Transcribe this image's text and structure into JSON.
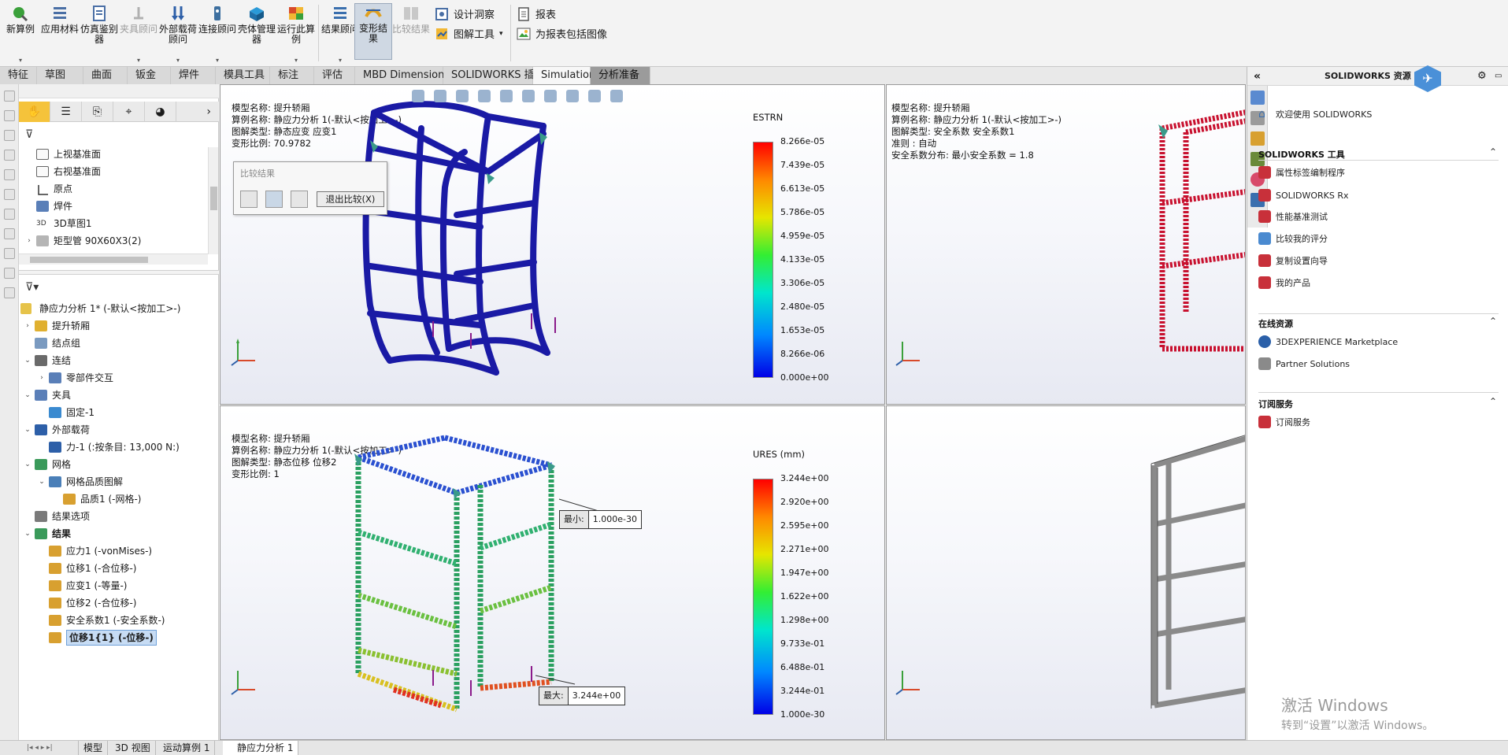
{
  "ribbon": {
    "buttons": [
      {
        "label": "新算例",
        "icon": "new-study-icon",
        "disabled": false,
        "color": "#2f8f2f"
      },
      {
        "label": "应用材料",
        "icon": "apply-material-icon",
        "disabled": false,
        "color": "#4a6fa5"
      },
      {
        "label": "仿真鉴别器",
        "icon": "simulation-evaluator-icon",
        "disabled": false,
        "color": "#4a6fa5"
      },
      {
        "label": "夹具顾问",
        "icon": "fixtures-advisor-icon",
        "disabled": true,
        "color": "#9a9a9a"
      },
      {
        "label": "外部载荷顾问",
        "icon": "external-loads-advisor-icon",
        "disabled": false,
        "color": "#2d5fa8"
      },
      {
        "label": "连接顾问",
        "icon": "connections-advisor-icon",
        "disabled": false,
        "color": "#3d6f9f"
      },
      {
        "label": "壳体管理器",
        "icon": "shell-manager-icon",
        "disabled": false,
        "color": "#1f7fb8"
      },
      {
        "label": "运行此算例",
        "icon": "run-study-icon",
        "disabled": false,
        "color": "#d84a2a"
      },
      {
        "label": "结果顾问",
        "icon": "results-advisor-icon",
        "disabled": false,
        "color": "#3a6fae"
      },
      {
        "label": "变形结果",
        "icon": "deformed-result-icon",
        "disabled": false,
        "active": true,
        "color": "#e0a020"
      },
      {
        "label": "比较结果",
        "icon": "compare-results-icon",
        "disabled": true,
        "color": "#9a9a9a"
      }
    ],
    "text_items": [
      {
        "label": "设计洞察",
        "icon": "design-insight-icon"
      },
      {
        "label": "图解工具",
        "icon": "plot-tools-icon"
      },
      {
        "label": "报表",
        "icon": "report-icon"
      },
      {
        "label": "为报表包括图像",
        "icon": "include-image-icon"
      }
    ]
  },
  "command_tabs": [
    "特征",
    "草图",
    "曲面",
    "钣金",
    "焊件",
    "模具工具",
    "标注",
    "评估",
    "MBD Dimensions",
    "SOLIDWORKS 插件",
    "Simulation",
    "分析准备"
  ],
  "feature_tree": {
    "items": [
      {
        "label": "上视基准面",
        "icon": "plane-icon"
      },
      {
        "label": "右视基准面",
        "icon": "plane-icon"
      },
      {
        "label": "原点",
        "icon": "origin-icon"
      },
      {
        "label": "焊件",
        "icon": "weldment-icon"
      },
      {
        "label": "3D草图1",
        "icon": "sketch3d-icon"
      },
      {
        "label": "矩型管 90X60X3(2)",
        "icon": "cutlist-icon"
      }
    ]
  },
  "sim_tree": {
    "root": "静应力分析 1* (-默认<按加工>-)",
    "items": [
      {
        "label": "提升轿厢",
        "level": 1,
        "arrow": "›",
        "icon": "part-icon"
      },
      {
        "label": "结点组",
        "level": 1,
        "arrow": "",
        "icon": "node-group-icon"
      },
      {
        "label": "连结",
        "level": 1,
        "arrow": "⌄",
        "icon": "connection-icon"
      },
      {
        "label": "零部件交互",
        "level": 2,
        "arrow": "›",
        "icon": "interaction-icon"
      },
      {
        "label": "夹具",
        "level": 1,
        "arrow": "⌄",
        "icon": "fixture-icon"
      },
      {
        "label": "固定-1",
        "level": 2,
        "arrow": "",
        "icon": "fixed-icon"
      },
      {
        "label": "外部载荷",
        "level": 1,
        "arrow": "⌄",
        "icon": "load-icon"
      },
      {
        "label": "力-1 (:按条目: 13,000 N:)",
        "level": 2,
        "arrow": "",
        "icon": "force-icon"
      },
      {
        "label": "网格",
        "level": 1,
        "arrow": "⌄",
        "icon": "mesh-icon"
      },
      {
        "label": "网格品质图解",
        "level": 2,
        "arrow": "⌄",
        "icon": "mesh-quality-icon"
      },
      {
        "label": "品质1 (-网格-)",
        "level": 3,
        "arrow": "",
        "icon": "plot-icon"
      },
      {
        "label": "结果选项",
        "level": 1,
        "arrow": "",
        "icon": "results-options-icon"
      },
      {
        "label": "结果",
        "level": 1,
        "arrow": "⌄",
        "icon": "results-folder-icon",
        "bold": true
      },
      {
        "label": "应力1 (-vonMises-)",
        "level": 2,
        "arrow": "",
        "icon": "plot-icon"
      },
      {
        "label": "位移1 (-合位移-)",
        "level": 2,
        "arrow": "",
        "icon": "plot-icon"
      },
      {
        "label": "应变1 (-等量-)",
        "level": 2,
        "arrow": "",
        "icon": "plot-icon"
      },
      {
        "label": "位移2 (-合位移-)",
        "level": 2,
        "arrow": "",
        "icon": "plot-icon"
      },
      {
        "label": "安全系数1 (-安全系数-)",
        "level": 2,
        "arrow": "",
        "icon": "plot-icon"
      },
      {
        "label": "位移1{1} (-位移-)",
        "level": 2,
        "arrow": "",
        "icon": "plot-icon",
        "highlighted": true
      }
    ]
  },
  "compare_dialog": {
    "title": "比较结果",
    "exit_label": "退出比较(X)"
  },
  "viewport_tl": {
    "info": [
      "模型名称: 提升轿厢",
      "算例名称: 静应力分析 1(-默认<按加工>-)",
      "图解类型: 静态应变 应变1",
      "变形比例: 70.9782"
    ],
    "legend_title": "ESTRN",
    "legend_values": [
      "8.266e-05",
      "7.439e-05",
      "6.613e-05",
      "5.786e-05",
      "4.959e-05",
      "4.133e-05",
      "3.306e-05",
      "2.480e-05",
      "1.653e-05",
      "8.266e-06",
      "0.000e+00"
    ]
  },
  "viewport_tr": {
    "info": [
      "模型名称: 提升轿厢",
      "算例名称: 静应力分析 1(-默认<按加工>-)",
      "图解类型: 安全系数 安全系数1",
      "准则 : 自动",
      "安全系数分布: 最小安全系数 = 1.8"
    ]
  },
  "viewport_bl": {
    "info": [
      "模型名称: 提升轿厢",
      "算例名称: 静应力分析 1(-默认<按加工>-)",
      "图解类型: 静态位移 位移2",
      "变形比例: 1"
    ],
    "legend_title": "URES (mm)",
    "legend_values": [
      "3.244e+00",
      "2.920e+00",
      "2.595e+00",
      "2.271e+00",
      "1.947e+00",
      "1.622e+00",
      "1.298e+00",
      "9.733e-01",
      "6.488e-01",
      "3.244e-01",
      "1.000e-30"
    ],
    "probe_min": {
      "key": "最小:",
      "value": "1.000e-30"
    },
    "probe_max": {
      "key": "最大:",
      "value": "3.244e+00"
    }
  },
  "task_pane": {
    "title": "SOLIDWORKS 资源",
    "welcome": "欢迎使用 SOLIDWORKS",
    "section_tools": "SOLIDWORKS 工具",
    "tools": [
      "属性标签编制程序",
      "SOLIDWORKS Rx",
      "性能基准测试",
      "比较我的评分",
      "复制设置向导",
      "我的产品"
    ],
    "section_online": "在线资源",
    "online": [
      "3DEXPERIENCE Marketplace",
      "Partner Solutions"
    ],
    "section_sub": "订阅服务",
    "sub": [
      "订阅服务"
    ]
  },
  "bottom_tabs": [
    "模型",
    "3D 视图",
    "运动算例 1",
    "静应力分析 1"
  ],
  "watermark": {
    "line1": "激活 Windows",
    "line2": "转到“设置”以激活 Windows。"
  },
  "colors": {
    "accent": "#f5c33b",
    "selection": "#c7dcf4",
    "frame_blue": "#1f1fa0",
    "frame_red": "#c8102e",
    "frame_gray": "#8a8a8a"
  }
}
